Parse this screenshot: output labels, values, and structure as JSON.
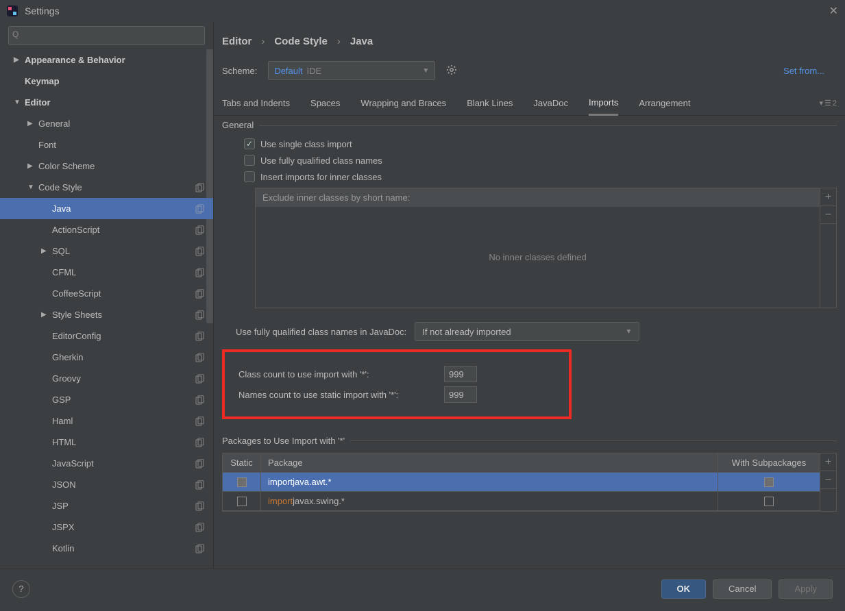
{
  "window": {
    "title": "Settings"
  },
  "search": {
    "placeholder": ""
  },
  "sidebar": {
    "items": [
      {
        "label": "Appearance & Behavior",
        "depth": 0,
        "arrow": "▶",
        "bold": true
      },
      {
        "label": "Keymap",
        "depth": 0,
        "arrow": "",
        "bold": true
      },
      {
        "label": "Editor",
        "depth": 0,
        "arrow": "▼",
        "bold": true
      },
      {
        "label": "General",
        "depth": 1,
        "arrow": "▶"
      },
      {
        "label": "Font",
        "depth": 1,
        "arrow": ""
      },
      {
        "label": "Color Scheme",
        "depth": 1,
        "arrow": "▶"
      },
      {
        "label": "Code Style",
        "depth": 1,
        "arrow": "▼",
        "dup": true
      },
      {
        "label": "Java",
        "depth": 2,
        "arrow": "",
        "dup": true,
        "selected": true
      },
      {
        "label": "ActionScript",
        "depth": 2,
        "arrow": "",
        "dup": true
      },
      {
        "label": "SQL",
        "depth": 2,
        "arrow": "▶",
        "dup": true
      },
      {
        "label": "CFML",
        "depth": 2,
        "arrow": "",
        "dup": true
      },
      {
        "label": "CoffeeScript",
        "depth": 2,
        "arrow": "",
        "dup": true
      },
      {
        "label": "Style Sheets",
        "depth": 2,
        "arrow": "▶",
        "dup": true
      },
      {
        "label": "EditorConfig",
        "depth": 2,
        "arrow": "",
        "dup": true
      },
      {
        "label": "Gherkin",
        "depth": 2,
        "arrow": "",
        "dup": true
      },
      {
        "label": "Groovy",
        "depth": 2,
        "arrow": "",
        "dup": true
      },
      {
        "label": "GSP",
        "depth": 2,
        "arrow": "",
        "dup": true
      },
      {
        "label": "Haml",
        "depth": 2,
        "arrow": "",
        "dup": true
      },
      {
        "label": "HTML",
        "depth": 2,
        "arrow": "",
        "dup": true
      },
      {
        "label": "JavaScript",
        "depth": 2,
        "arrow": "",
        "dup": true
      },
      {
        "label": "JSON",
        "depth": 2,
        "arrow": "",
        "dup": true
      },
      {
        "label": "JSP",
        "depth": 2,
        "arrow": "",
        "dup": true
      },
      {
        "label": "JSPX",
        "depth": 2,
        "arrow": "",
        "dup": true
      },
      {
        "label": "Kotlin",
        "depth": 2,
        "arrow": "",
        "dup": true
      }
    ]
  },
  "breadcrumb": {
    "a": "Editor",
    "b": "Code Style",
    "c": "Java"
  },
  "scheme": {
    "label": "Scheme:",
    "value": "Default",
    "scope": "IDE"
  },
  "setfrom": "Set from...",
  "tabs": [
    "Tabs and Indents",
    "Spaces",
    "Wrapping and Braces",
    "Blank Lines",
    "JavaDoc",
    "Imports",
    "Arrangement"
  ],
  "tabs_more": "2",
  "active_tab": 5,
  "general": {
    "title": "General",
    "cb_single": "Use single class import",
    "cb_fqn": "Use fully qualified class names",
    "cb_inner": "Insert imports for inner classes",
    "exclude_header": "Exclude inner classes by short name:",
    "exclude_empty": "No inner classes defined"
  },
  "javadoc": {
    "label": "Use fully qualified class names in JavaDoc:",
    "value": "If not already imported"
  },
  "counts": {
    "class_label": "Class count to use import with '*':",
    "class_value": "999",
    "names_label": "Names count to use static import with '*':",
    "names_value": "999"
  },
  "packages": {
    "title": "Packages to Use Import with '*'",
    "col_static": "Static",
    "col_package": "Package",
    "col_sub": "With Subpackages",
    "rows": [
      {
        "kw": "import",
        "text": " java.awt.*",
        "selected": true,
        "static": false,
        "sub": true
      },
      {
        "kw": "import",
        "text": " javax.swing.*",
        "selected": false,
        "static": false,
        "sub": false
      }
    ]
  },
  "buttons": {
    "ok": "OK",
    "cancel": "Cancel",
    "apply": "Apply"
  }
}
